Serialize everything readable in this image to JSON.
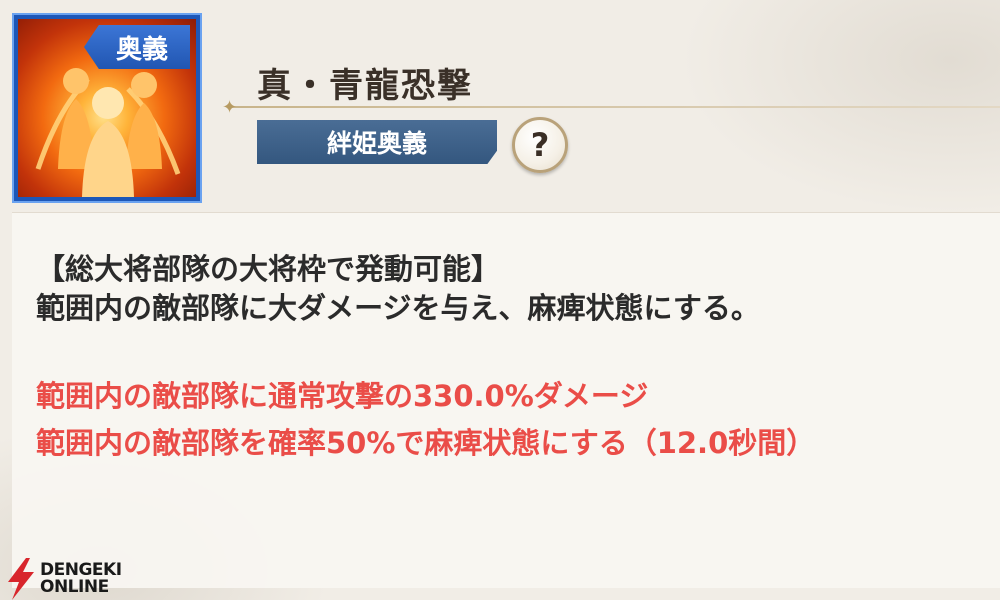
{
  "skill": {
    "tag": "奥義",
    "name": "真・青龍恐撃",
    "category": "絆姫奥義",
    "help_label": "?"
  },
  "description": {
    "condition": "【総大将部隊の大将枠で発動可能】",
    "summary": "範囲内の敵部隊に大ダメージを与え、麻痺状態にする。",
    "effects": [
      "範囲内の敵部隊に通常攻撃の330.0%ダメージ",
      "範囲内の敵部隊を確率50%で麻痺状態にする（12.0秒間）"
    ]
  },
  "watermark": {
    "line1": "DENGEKI",
    "line2": "ONLINE"
  },
  "colors": {
    "effect_text": "#ea4d48",
    "badge": "#34577f",
    "icon_frame": "#1d57b8"
  }
}
